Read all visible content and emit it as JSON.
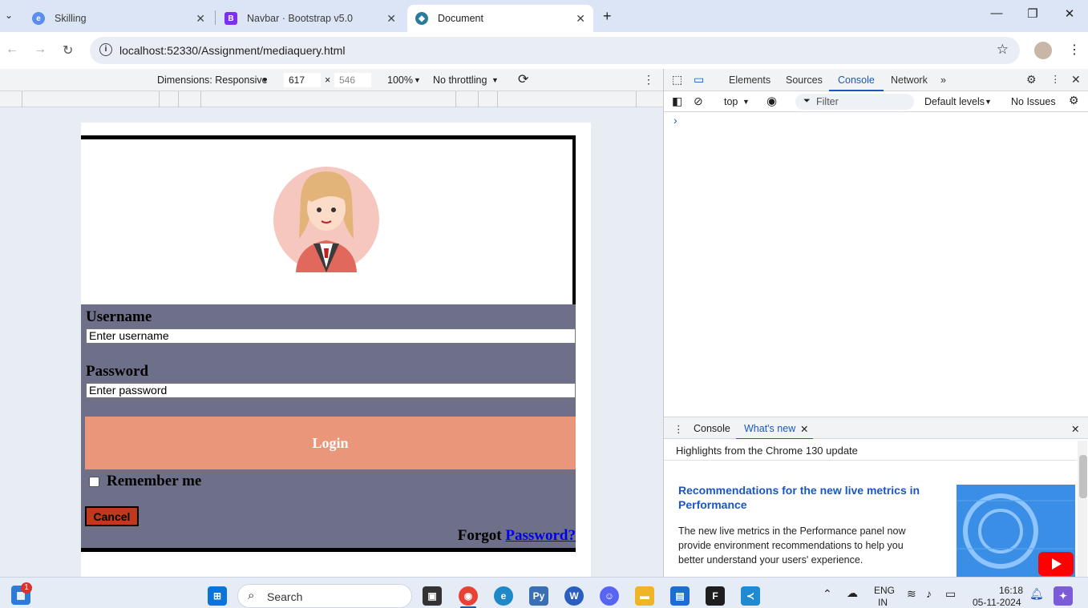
{
  "browser": {
    "tabs": [
      {
        "title": "Skilling",
        "active": false
      },
      {
        "title": "Navbar · Bootstrap v5.0",
        "active": false
      },
      {
        "title": "Document",
        "active": true
      }
    ],
    "new_tab": "+",
    "url": "localhost:52330/Assignment/mediaquery.html"
  },
  "device_toolbar": {
    "dimensions_label": "Dimensions: Responsive",
    "width": "617",
    "times": "×",
    "height": "546",
    "zoom": "100%",
    "throttling": "No throttling"
  },
  "page": {
    "username_label": "Username",
    "username_placeholder": "Enter username",
    "password_label": "Password",
    "password_placeholder": "Enter password",
    "login_label": "Login",
    "remember_label": "Remember me",
    "cancel_label": "Cancel",
    "forgot_text": "Forgot",
    "forgot_link": "Password?"
  },
  "devtools": {
    "tabs": [
      "Elements",
      "Sources",
      "Console",
      "Network"
    ],
    "active_tab": "Console",
    "context": "top",
    "filter_placeholder": "Filter",
    "levels": "Default levels",
    "issues": "No Issues",
    "prompt": "›",
    "drawer": {
      "tabs": [
        "Console",
        "What's new"
      ],
      "active_tab": "What's new",
      "header": "Highlights from the Chrome 130 update",
      "article_title": "Recommendations for the new live metrics in Performance",
      "article_body": "The new live metrics in the Performance panel now provide environment recommendations to help you better understand your users' experience."
    }
  },
  "taskbar": {
    "search_placeholder": "Search",
    "notification_count": "1",
    "language": "ENG",
    "region": "IN",
    "time": "16:18",
    "date": "05-11-2024"
  },
  "colors": {
    "form_bg": "#6e6f88",
    "login_bg": "#e9967a",
    "cancel_bg": "#c0391b",
    "devtools_accent": "#1a57c0"
  }
}
